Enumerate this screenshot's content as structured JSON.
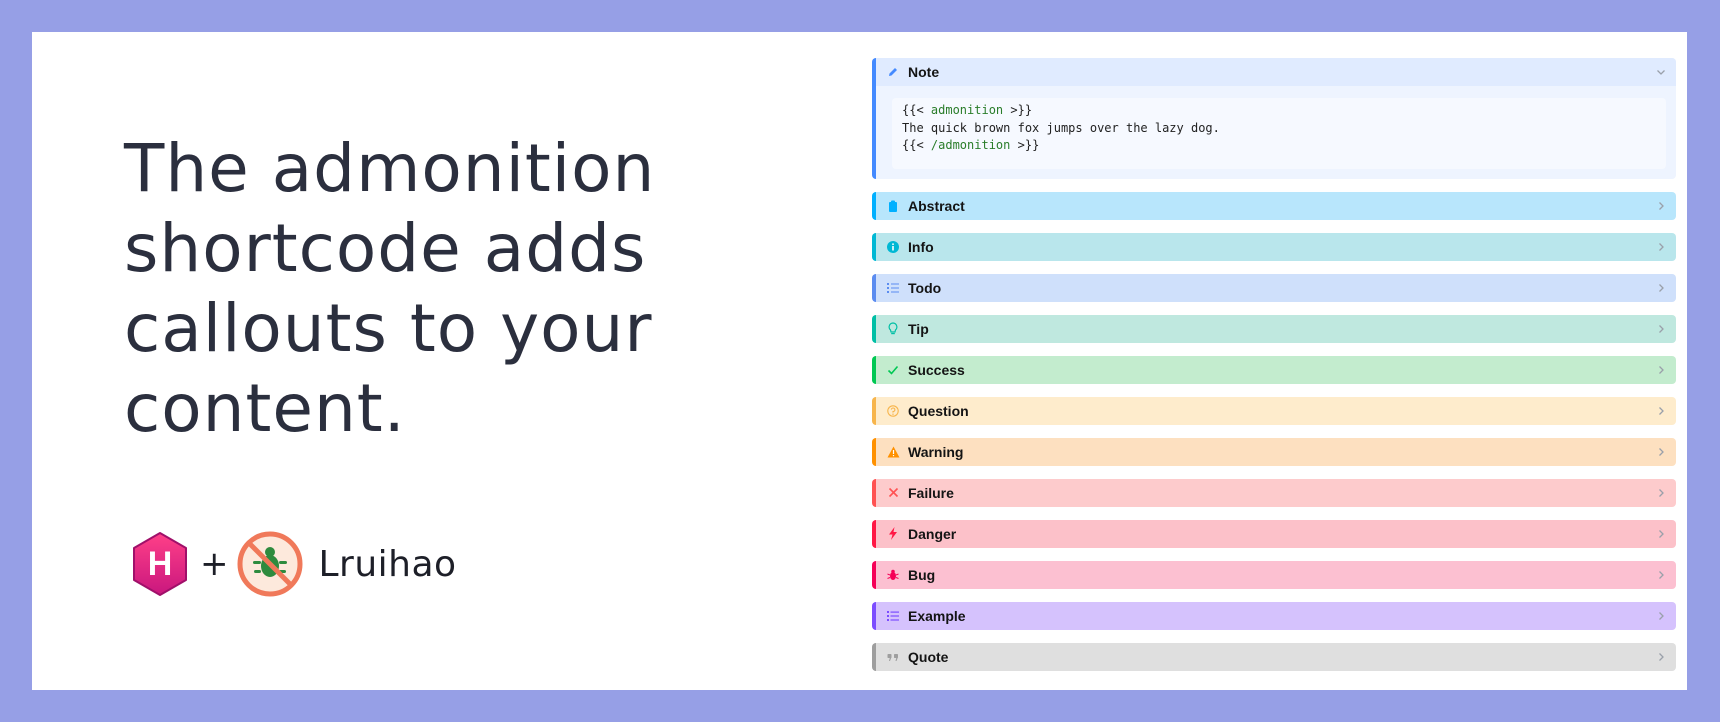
{
  "headline": "The admonition shortcode adds callouts to your content.",
  "brand": {
    "hugo_letter": "H",
    "plus": "+",
    "name": "Lruihao"
  },
  "admonitions": [
    {
      "key": "note",
      "title": "Note",
      "icon": "pencil-icon",
      "color": "#448aff",
      "bg": "#e0ebff",
      "open": true,
      "code": {
        "line1_open": "{{< ",
        "line1_kw": "admonition",
        "line1_close": " >}}",
        "line2": "The quick brown fox jumps over the lazy dog.",
        "line3_open": "{{< ",
        "line3_kw": "/admonition",
        "line3_close": " >}}"
      }
    },
    {
      "key": "abstract",
      "title": "Abstract",
      "icon": "clipboard-icon",
      "color": "#00b0ff",
      "bg": "#b8e6fc"
    },
    {
      "key": "info",
      "title": "Info",
      "icon": "info-icon",
      "color": "#00b8d4",
      "bg": "#b9e6ec"
    },
    {
      "key": "todo",
      "title": "Todo",
      "icon": "checklist-icon",
      "color": "#5b8cf0",
      "bg": "#cfe0fb"
    },
    {
      "key": "tip",
      "title": "Tip",
      "icon": "lightbulb-icon",
      "color": "#00bfa5",
      "bg": "#bfe8df"
    },
    {
      "key": "success",
      "title": "Success",
      "icon": "check-icon",
      "color": "#00c853",
      "bg": "#c3ecce"
    },
    {
      "key": "question",
      "title": "Question",
      "icon": "question-icon",
      "color": "#f7b54c",
      "bg": "#feeccc"
    },
    {
      "key": "warning",
      "title": "Warning",
      "icon": "warning-icon",
      "color": "#ff9100",
      "bg": "#fde0c0"
    },
    {
      "key": "failure",
      "title": "Failure",
      "icon": "x-icon",
      "color": "#ff5252",
      "bg": "#fdcbcc"
    },
    {
      "key": "danger",
      "title": "Danger",
      "icon": "lightning-icon",
      "color": "#ff1744",
      "bg": "#fcc1c9"
    },
    {
      "key": "bug",
      "title": "Bug",
      "icon": "bug-icon",
      "color": "#f50057",
      "bg": "#fcc0d1"
    },
    {
      "key": "example",
      "title": "Example",
      "icon": "list-icon",
      "color": "#7c4dff",
      "bg": "#d5c2fd"
    },
    {
      "key": "quote",
      "title": "Quote",
      "icon": "quote-icon",
      "color": "#9e9e9e",
      "bg": "#dfdfdf"
    }
  ]
}
